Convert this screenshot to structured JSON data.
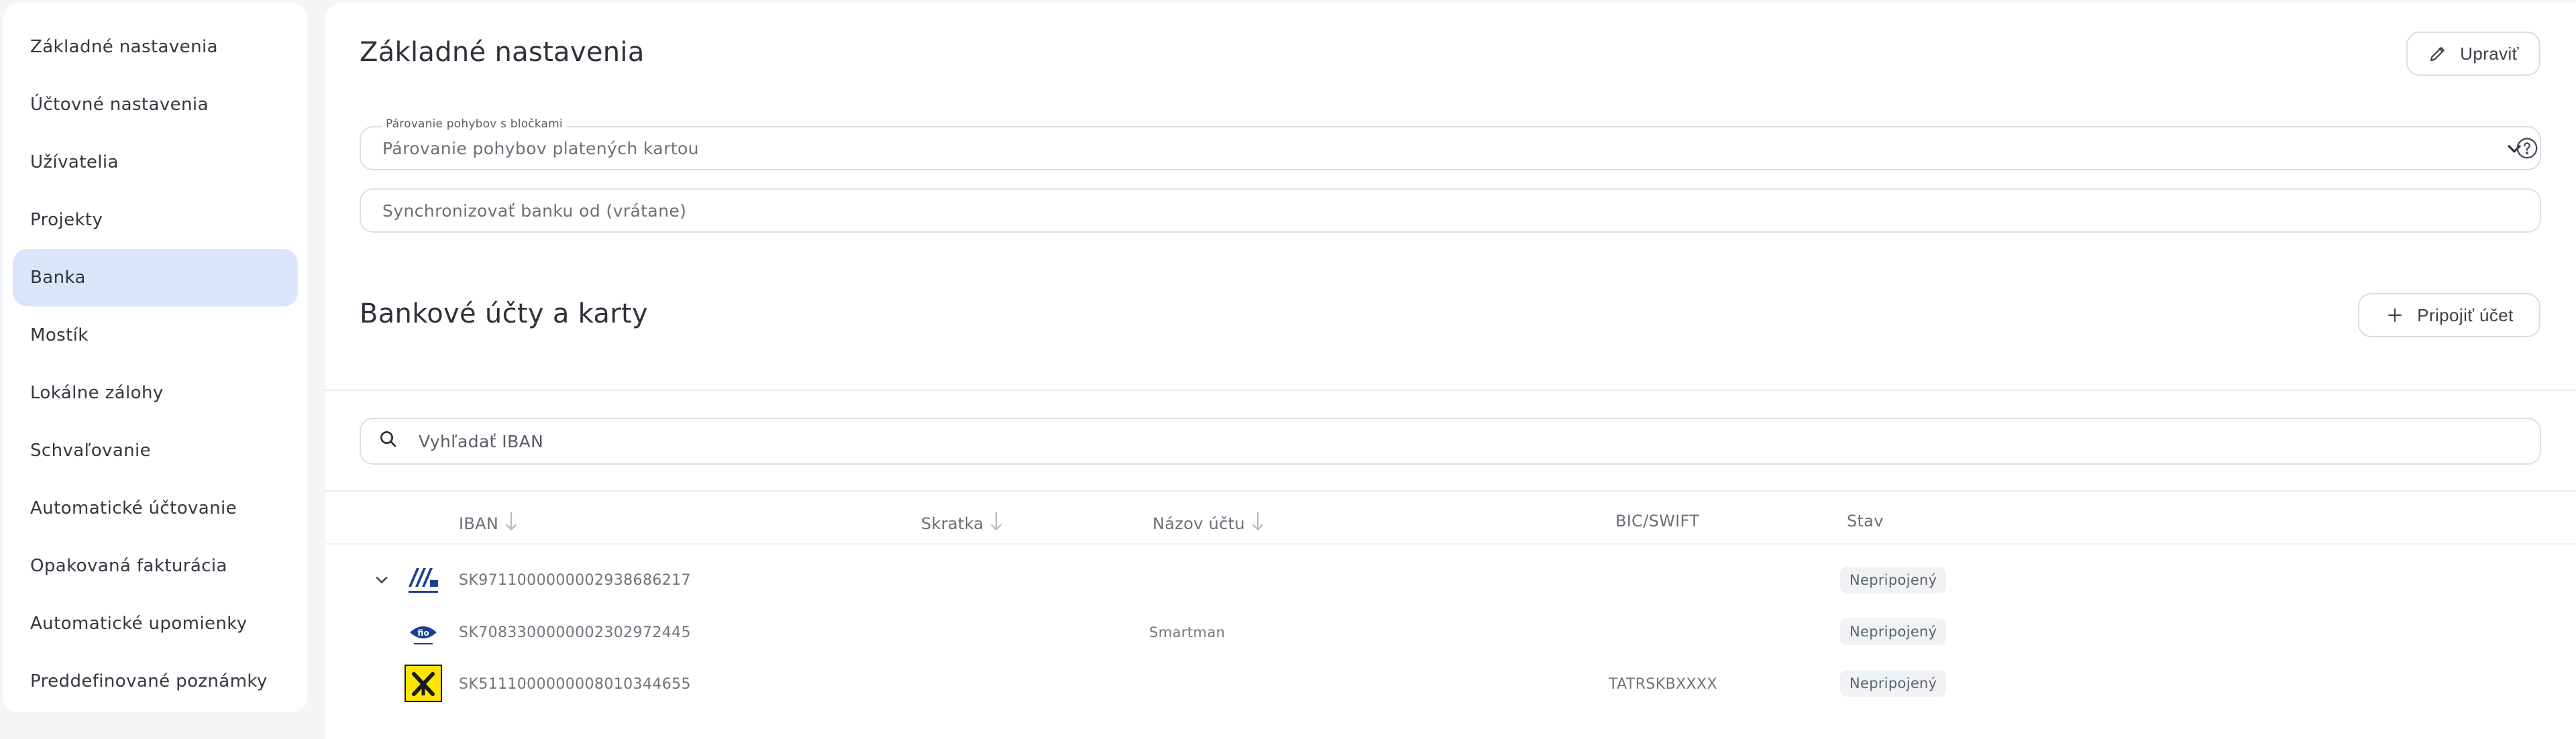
{
  "sidebar": {
    "items": [
      {
        "label": "Základné nastavenia"
      },
      {
        "label": "Účtovné nastavenia"
      },
      {
        "label": "Užívatelia"
      },
      {
        "label": "Projekty"
      },
      {
        "label": "Banka"
      },
      {
        "label": "Mostík"
      },
      {
        "label": "Lokálne zálohy"
      },
      {
        "label": "Schvaľovanie"
      },
      {
        "label": "Automatické účtovanie"
      },
      {
        "label": "Opakovaná fakturácia"
      },
      {
        "label": "Automatické upomienky"
      },
      {
        "label": "Preddefinované poznámky"
      }
    ],
    "active_index": 4
  },
  "basic": {
    "title": "Základné nastavenia",
    "edit_label": "Upraviť",
    "pairing_label": "Párovanie pohybov s bločkami",
    "pairing_value": "Párovanie pohybov platených kartou",
    "sync_placeholder": "Synchronizovať banku od (vrátane)"
  },
  "accounts": {
    "title": "Bankové účty a karty",
    "connect_label": "Pripojiť účet",
    "search_placeholder": "Vyhľadať IBAN",
    "columns": {
      "iban": "IBAN",
      "short": "Skratka",
      "name": "Názov účtu",
      "bic": "BIC/SWIFT",
      "status": "Stav"
    },
    "rows": [
      {
        "iban": "SK9711000000002938686217",
        "short": "",
        "name": "",
        "bic": "",
        "status": "Nepripojený",
        "logo": "bank-logo-blue-icon"
      },
      {
        "iban": "SK7083300000002302972445",
        "short": "",
        "name": "Smartman",
        "bic": "",
        "status": "Nepripojený",
        "logo": "fio-logo-icon"
      },
      {
        "iban": "SK5111000000008010344655",
        "short": "",
        "name": "",
        "bic": "TATRSKBXXXX",
        "status": "Nepripojený",
        "logo": "raiffeisen-logo-icon"
      }
    ]
  },
  "colors": {
    "accent_active": "#d9e6f9",
    "raiffeisen_yellow": "#ffe500",
    "bank_blue": "#1f3f95"
  }
}
